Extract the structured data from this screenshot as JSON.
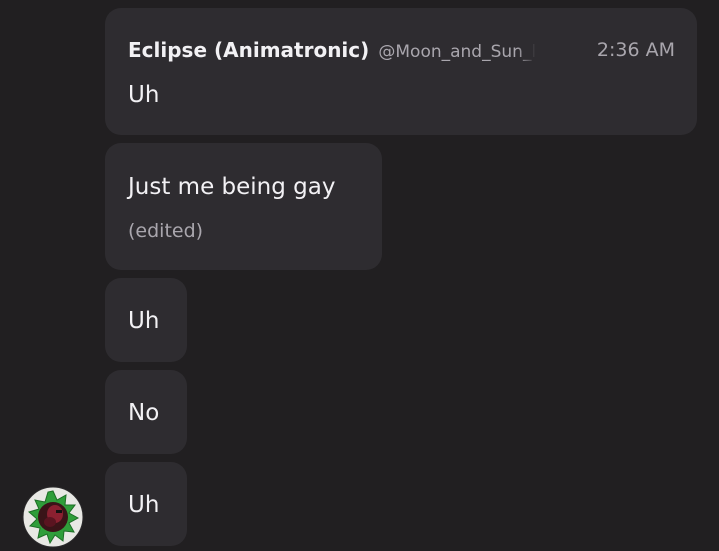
{
  "header": {
    "author": "Eclipse (Animatronic)",
    "handle": "@Moon_and_Sun_l",
    "time": "2:36 AM"
  },
  "messages": [
    {
      "text": "Uh"
    },
    {
      "text": "Just me being gay",
      "edited_label": "(edited)"
    },
    {
      "text": "Uh"
    },
    {
      "text": "No"
    },
    {
      "text": "Uh"
    }
  ],
  "colors": {
    "background": "#211f21",
    "bubble": "#2e2c30",
    "text": "#f2f1f4",
    "muted": "#a9a6ad",
    "avatar_ring": "#2f9e3a"
  },
  "avatar": {
    "icon": "user-avatar-icon"
  }
}
